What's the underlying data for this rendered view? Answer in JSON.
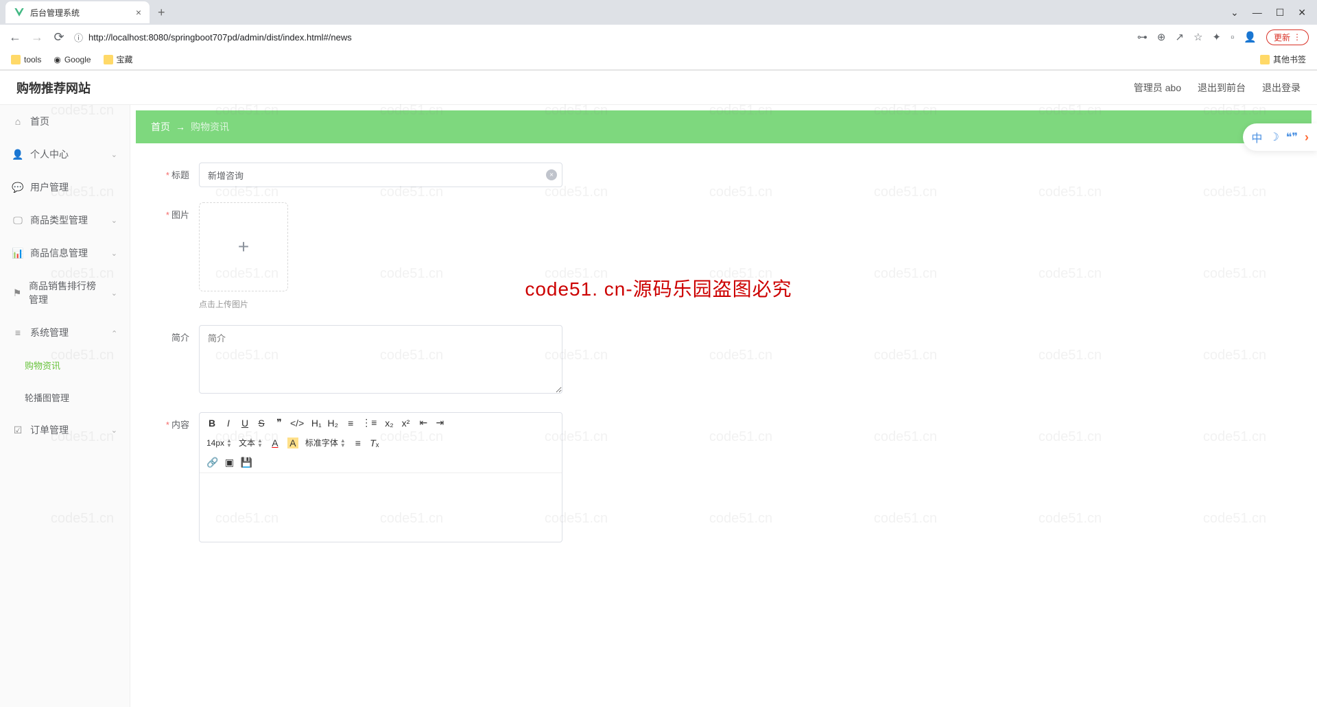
{
  "browser": {
    "tab_title": "后台管理系统",
    "url": "http://localhost:8080/springboot707pd/admin/dist/index.html#/news",
    "update_label": "更新",
    "bookmarks": [
      "tools",
      "Google",
      "宝藏"
    ],
    "other_bookmarks": "其他书签"
  },
  "header": {
    "title": "购物推荐网站",
    "user": "管理员 abo",
    "front_link": "退出到前台",
    "logout": "退出登录"
  },
  "sidebar": {
    "items": [
      {
        "icon": "home",
        "label": "首页"
      },
      {
        "icon": "user",
        "label": "个人中心",
        "arrow": "down"
      },
      {
        "icon": "comment",
        "label": "用户管理"
      },
      {
        "icon": "monitor",
        "label": "商品类型管理",
        "arrow": "down"
      },
      {
        "icon": "chart",
        "label": "商品信息管理",
        "arrow": "down"
      },
      {
        "icon": "flag",
        "label": "商品销售排行榜管理",
        "arrow": "down"
      },
      {
        "icon": "list",
        "label": "系统管理",
        "arrow": "up"
      },
      {
        "icon": "",
        "label": "购物资讯",
        "active": true,
        "sub": true
      },
      {
        "icon": "",
        "label": "轮播图管理",
        "sub": true
      },
      {
        "icon": "check",
        "label": "订单管理",
        "arrow": "down"
      }
    ]
  },
  "breadcrumb": {
    "home": "首页",
    "current": "购物资讯"
  },
  "form": {
    "title_label": "标题",
    "title_value": "新增咨询",
    "image_label": "图片",
    "upload_hint": "点击上传图片",
    "intro_label": "简介",
    "intro_placeholder": "简介",
    "content_label": "内容",
    "editor": {
      "font_size": "14px",
      "format": "文本",
      "font_family": "标准字体"
    }
  },
  "watermark": "code51. cn-源码乐园盗图必究",
  "wm_small": "code51.cn",
  "float": {
    "cn": "中"
  }
}
